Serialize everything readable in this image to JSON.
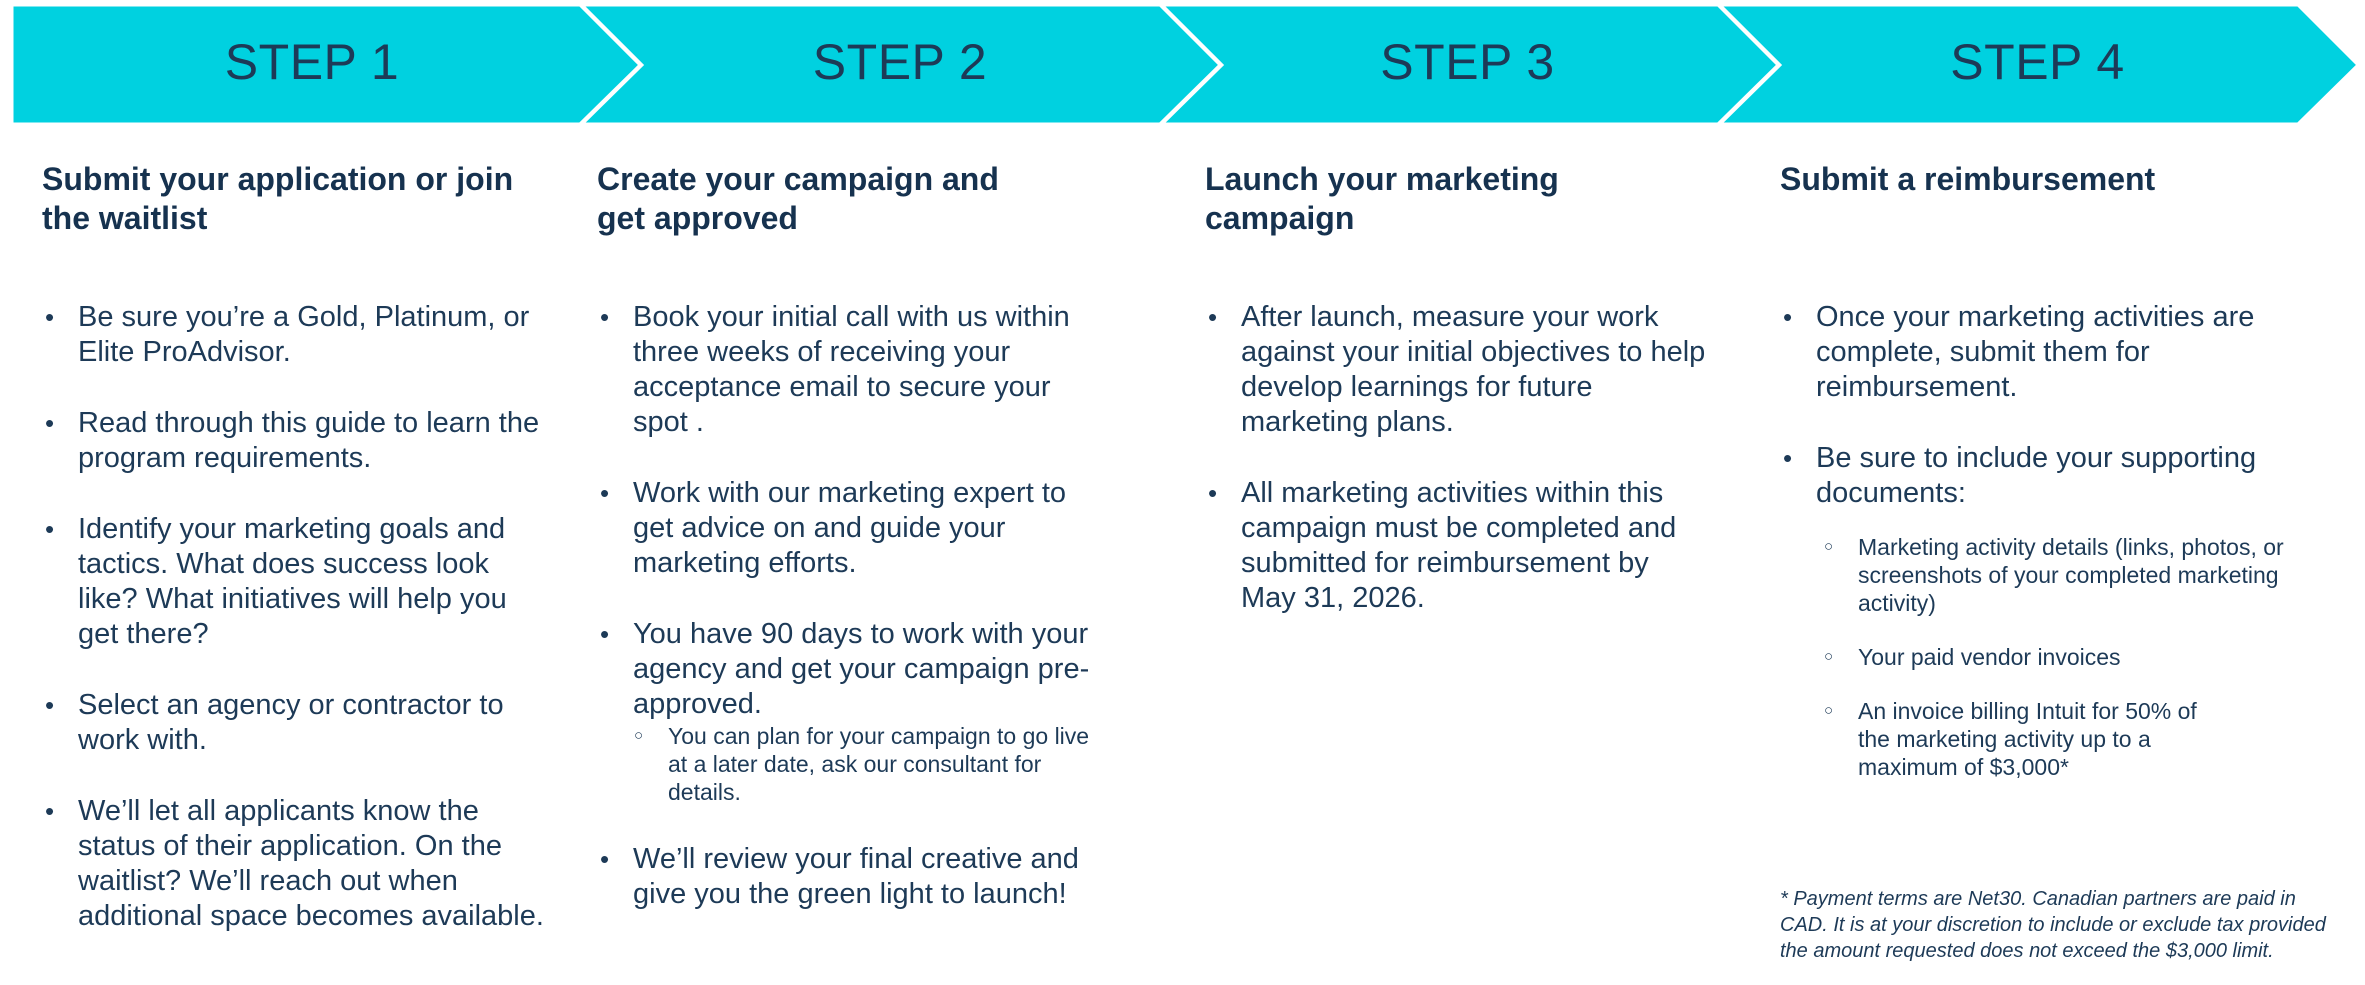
{
  "colors": {
    "chevron_fill": "#00d1e0",
    "heading_text": "#16324f",
    "body_text": "#1d3a57"
  },
  "steps": [
    {
      "label": "STEP 1",
      "heading": "Submit your application or join the waitlist",
      "items": [
        {
          "text": "Be sure you’re a Gold, Platinum, or Elite ProAdvisor."
        },
        {
          "text": "Read through this guide to learn the program requirements."
        },
        {
          "text": "Identify your marketing goals and tactics. What does success look like? What initiatives will help you get there?"
        },
        {
          "text": "Select an agency or contractor to work with."
        },
        {
          "text": "We’ll let all applicants know the status of their application. On the waitlist? We’ll reach out when additional space becomes available."
        }
      ]
    },
    {
      "label": "STEP 2",
      "heading": "Create your campaign and get approved",
      "items": [
        {
          "text": "Book your initial call with us within three weeks of receiving your acceptance email to secure your spot ."
        },
        {
          "text": "Work with our marketing expert to get advice on and guide your marketing efforts."
        },
        {
          "text": "You have 90 days to work with your agency and get your campaign pre-approved.",
          "sub": [
            "You can plan for your campaign to go live at a later date, ask our consultant for details."
          ]
        },
        {
          "text": "We’ll review your final creative and give you the green light to launch!"
        }
      ]
    },
    {
      "label": "STEP 3",
      "heading": "Launch your marketing campaign",
      "items": [
        {
          "text": "After launch, measure your work against your initial objectives to help develop learnings for future marketing plans."
        },
        {
          "text": "All marketing activities within this campaign must be completed and submitted for reimbursement by May 31, 2026."
        }
      ]
    },
    {
      "label": "STEP 4",
      "heading": "Submit a reimbursement",
      "items": [
        {
          "text": "Once your marketing activities are complete, submit them for reimbursement."
        },
        {
          "text": "Be sure to include your supporting documents:",
          "sub": [
            "Marketing activity details (links, photos, or screenshots of your completed marketing activity)",
            "Your paid vendor invoices",
            "An invoice billing Intuit for 50% of the marketing activity up to a maximum of $3,000*"
          ]
        }
      ]
    }
  ],
  "footnote": "* Payment terms are Net30. Canadian partners are paid in CAD. It is at your discretion to include or exclude tax provided the amount requested does not exceed the $3,000 limit."
}
